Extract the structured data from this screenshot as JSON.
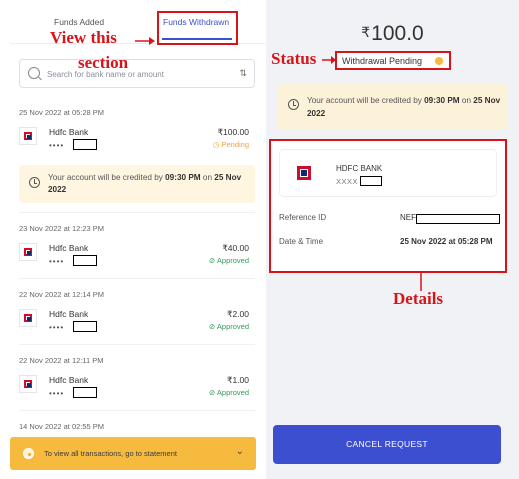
{
  "tabs": {
    "added": "Funds Added",
    "withdrawn": "Funds Withdrawn"
  },
  "annotations": {
    "view_line1": "View this",
    "view_line2": "section",
    "status": "Status",
    "details": "Details"
  },
  "search": {
    "placeholder": "Search for bank name or amount"
  },
  "transactions": [
    {
      "date": "25 Nov 2022 at 05:28 PM",
      "bank": "Hdfc Bank",
      "mask": "••••",
      "amount": "₹100.00",
      "status": "Pending",
      "status_icon": "clock-icon"
    },
    {
      "date": "23 Nov 2022 at 12:23 PM",
      "bank": "Hdfc Bank",
      "mask": "••••",
      "amount": "₹40.00",
      "status": "Approved",
      "status_icon": "check-circle-icon"
    },
    {
      "date": "22 Nov 2022 at 12:14 PM",
      "bank": "Hdfc Bank",
      "mask": "••••",
      "amount": "₹2.00",
      "status": "Approved",
      "status_icon": "check-circle-icon"
    },
    {
      "date": "22 Nov 2022 at 12:11 PM",
      "bank": "Hdfc Bank",
      "mask": "••••",
      "amount": "₹1.00",
      "status": "Approved",
      "status_icon": "check-circle-icon"
    }
  ],
  "last_date": "14 Nov 2022 at 02:55 PM",
  "left_notice": {
    "prefix": "Your account will be credited by ",
    "time": "09:30 PM",
    "middle": " on ",
    "date": "25 Nov 2022"
  },
  "bottom_bar": {
    "text": "To view all transactions, go to statement"
  },
  "detail": {
    "currency": "₹",
    "amount": "100.0",
    "status": "Withdrawal Pending",
    "notice_prefix": "Your account will be credited by ",
    "notice_time": "09:30 PM",
    "notice_middle": " on ",
    "notice_date": "25 Nov 2022",
    "bank_name": "HDFC BANK",
    "bank_mask": "XXXX",
    "ref_label": "Reference ID",
    "ref_value": "NEFT",
    "datetime_label": "Date & Time",
    "datetime_value": "25 Nov 2022 at 05:28 PM",
    "cancel_label": "CANCEL REQUEST"
  },
  "colors": {
    "accent": "#3d4fd1",
    "annotation_red": "#d8141b",
    "pending": "#f3a33b",
    "approved": "#2e9e58",
    "notice_bg": "#fff6e2"
  }
}
